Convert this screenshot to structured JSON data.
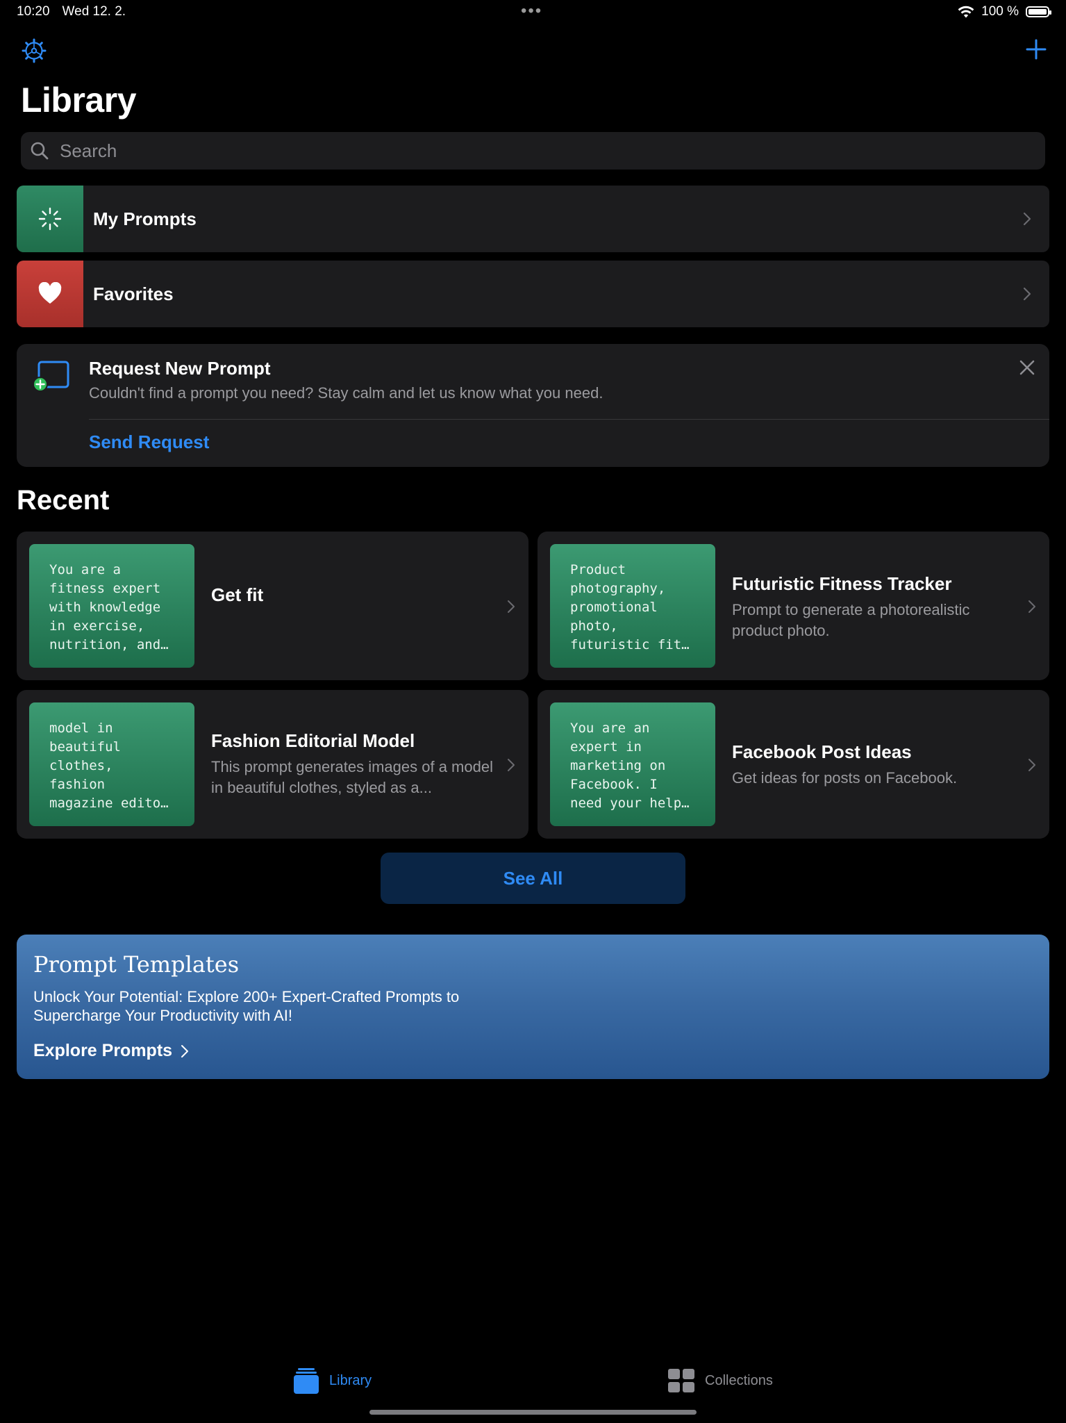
{
  "status_bar": {
    "time": "10:20",
    "date": "Wed 12. 2.",
    "battery": "100 %"
  },
  "header": {
    "title": "Library"
  },
  "search": {
    "placeholder": "Search"
  },
  "rows": [
    {
      "label": "My Prompts",
      "icon": "sparkle-icon",
      "color": "#2f8a64"
    },
    {
      "label": "Favorites",
      "icon": "heart-icon",
      "color": "#c9403a"
    }
  ],
  "request": {
    "title": "Request New Prompt",
    "description": "Couldn't find a prompt you need? Stay calm and let us know what you need.",
    "action": "Send Request"
  },
  "recent": {
    "heading": "Recent",
    "items": [
      {
        "preview": "You are a\nfitness expert\nwith knowledge\nin exercise,\nnutrition, and…",
        "title": "Get fit",
        "description": ""
      },
      {
        "preview": "Product\nphotography,\npromotional\nphoto,\nfuturistic fit…",
        "title": "Futuristic Fitness Tracker",
        "description": "Prompt to generate a photorealistic product photo."
      },
      {
        "preview": "model in\nbeautiful\nclothes,\nfashion\nmagazine edito…",
        "title": "Fashion Editorial Model",
        "description": "This prompt generates images of a model in beautiful clothes, styled as a..."
      },
      {
        "preview": "You are an\nexpert in\nmarketing on\nFacebook. I\nneed your help…",
        "title": "Facebook Post Ideas",
        "description": "Get ideas for posts on Facebook."
      }
    ],
    "see_all": "See All"
  },
  "templates": {
    "title": "Prompt Templates",
    "description": "Unlock Your Potential: Explore 200+ Expert-Crafted Prompts to Supercharge Your Productivity with AI!",
    "action": "Explore Prompts"
  },
  "tabs": [
    {
      "label": "Library",
      "icon": "library-icon",
      "active": true
    },
    {
      "label": "Collections",
      "icon": "collections-icon",
      "active": false
    }
  ],
  "colors": {
    "accent": "#2f8bf5",
    "card": "#1c1c1e",
    "background": "#000000"
  }
}
